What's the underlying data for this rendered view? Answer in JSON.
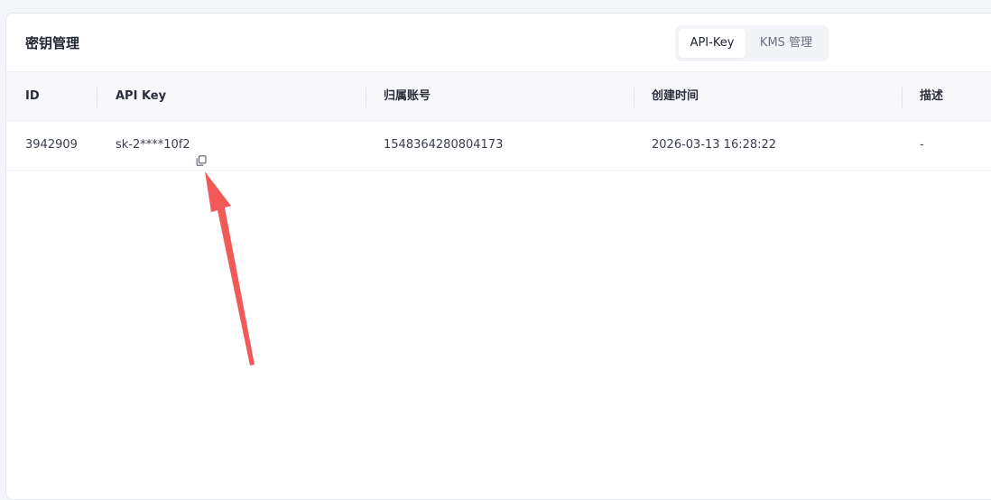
{
  "panel": {
    "title": "密钥管理",
    "tabs": [
      {
        "label": "API-Key",
        "active": true
      },
      {
        "label": "KMS 管理",
        "active": false
      }
    ]
  },
  "table": {
    "columns": [
      "ID",
      "API Key",
      "归属账号",
      "创建时间",
      "描述"
    ],
    "rows": [
      {
        "id": "3942909",
        "api_key": "sk-2****10f2",
        "account": "1548364280804173",
        "created_at": "2026-03-13 16:28:22",
        "description": "-"
      }
    ]
  },
  "icons": {
    "copy": "copy-icon",
    "annotation": "red-arrow"
  },
  "colors": {
    "arrow": "#f25a5a",
    "header_bg": "#f8f8fb"
  }
}
